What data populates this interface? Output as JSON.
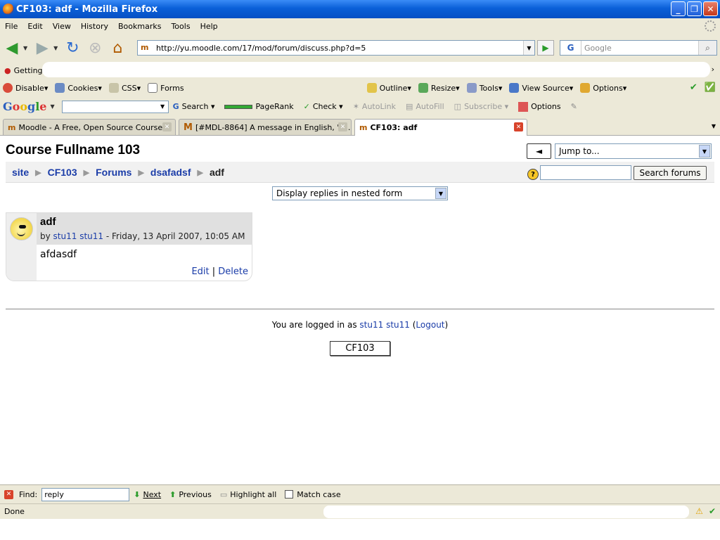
{
  "window": {
    "title": "CF103: adf - Mozilla Firefox"
  },
  "menu": [
    "File",
    "Edit",
    "View",
    "History",
    "Bookmarks",
    "Tools",
    "Help"
  ],
  "navbar": {
    "url": "http://yu.moodle.com/17/mod/forum/discuss.php?d=5",
    "search_placeholder": "Google"
  },
  "bookmarks": {
    "first": "Getting"
  },
  "webdev": [
    "Disable",
    "Cookies",
    "CSS",
    "Forms",
    "Outline",
    "Resize",
    "Tools",
    "View Source",
    "Options"
  ],
  "googlebar": {
    "logo": "Google",
    "search": "Search",
    "pagerank": "PageRank",
    "check": "Check",
    "autolink": "AutoLink",
    "autofill": "AutoFill",
    "subscribe": "Subscribe",
    "options": "Options"
  },
  "tabs": [
    {
      "label": "Moodle - A Free, Open Source Course...",
      "active": false
    },
    {
      "label": "[#MDL-8864] A message in English, \"S...",
      "active": false
    },
    {
      "label": "CF103: adf",
      "active": true
    }
  ],
  "page": {
    "course_title": "Course Fullname 103",
    "jumpback": "◄",
    "jumpto": "Jump to...",
    "breadcrumb": [
      "site",
      "CF103",
      "Forums",
      "dsafadsf"
    ],
    "breadcrumb_current": "adf",
    "search_button": "Search forums",
    "display_mode": "Display replies in nested form",
    "post": {
      "title": "adf",
      "by_prefix": "by",
      "author": "stu11 stu11",
      "date": " - Friday, 13 April 2007, 10:05 AM",
      "body": "afdasdf",
      "edit": "Edit",
      "delete": "Delete"
    },
    "login": {
      "prefix": "You are logged in as",
      "user": "stu11 stu11",
      "logout": "Logout"
    },
    "home_button": "CF103"
  },
  "findbar": {
    "label": "Find:",
    "value": "reply",
    "next": "Next",
    "previous": "Previous",
    "highlight": "Highlight all",
    "matchcase": "Match case"
  },
  "status": {
    "text": "Done"
  }
}
